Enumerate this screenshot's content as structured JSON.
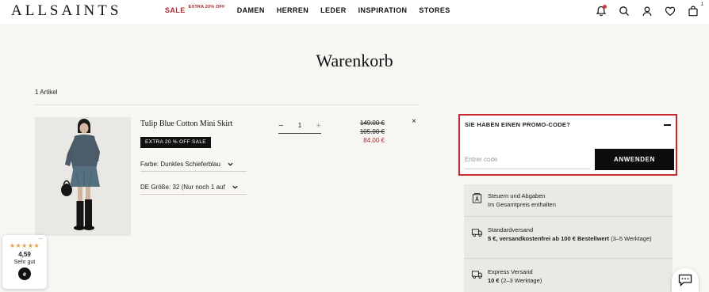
{
  "header": {
    "logo": "ALLSAINTS",
    "nav": {
      "sale": "SALE",
      "sale_sup": "EXTRA 20% OFF",
      "damen": "DAMEN",
      "herren": "HERREN",
      "leder": "LEDER",
      "inspiration": "INSPIRATION",
      "stores": "STORES"
    },
    "icons": [
      "bell-icon",
      "search-icon",
      "account-icon",
      "heart-icon",
      "bag-icon"
    ],
    "bag_count": "1"
  },
  "page": {
    "title": "Warenkorb",
    "item_count": "1 Artikel"
  },
  "cart_item": {
    "name": "Tulip Blue Cotton Mini Skirt",
    "badge": "EXTRA 20 % OFF SALE",
    "color_select": "Farbe: Dunkles Schieferblau",
    "size_select": "DE Größe: 32 (Nur noch 1 auf",
    "quantity": "1",
    "minus": "−",
    "plus": "+",
    "price_original": "149.00 €",
    "price_reduced": "105.00 €",
    "price_final": "84.00 €",
    "remove": "×"
  },
  "promo": {
    "title": "SIE HABEN EINEN PROMO-CODE?",
    "placeholder": "Entrer code",
    "button": "ANWENDEN"
  },
  "info": {
    "taxes_title": "Steuern und Abgaben",
    "taxes_sub": "Im Gesamtpreis enthalten",
    "standard_title": "Standardversand",
    "standard_bold": "5 €, versandkostenfrei ab 100 € Bestellwert",
    "standard_rest": " (3–5 Werktage)",
    "express_title": "Express Versand",
    "express_bold": "10 €",
    "express_rest": " (2–3 Werktage)"
  },
  "trust_badge": {
    "dots": "...",
    "stars": "★★★★★",
    "rating": "4,59",
    "label": "Sehr gut",
    "logo": "e"
  },
  "colors": {
    "sale_red": "#b3262c",
    "promo_border": "#c8272d",
    "background": "#f7f6f3",
    "info_panel": "#ebe9e4",
    "button_black": "#0d0d0d"
  }
}
